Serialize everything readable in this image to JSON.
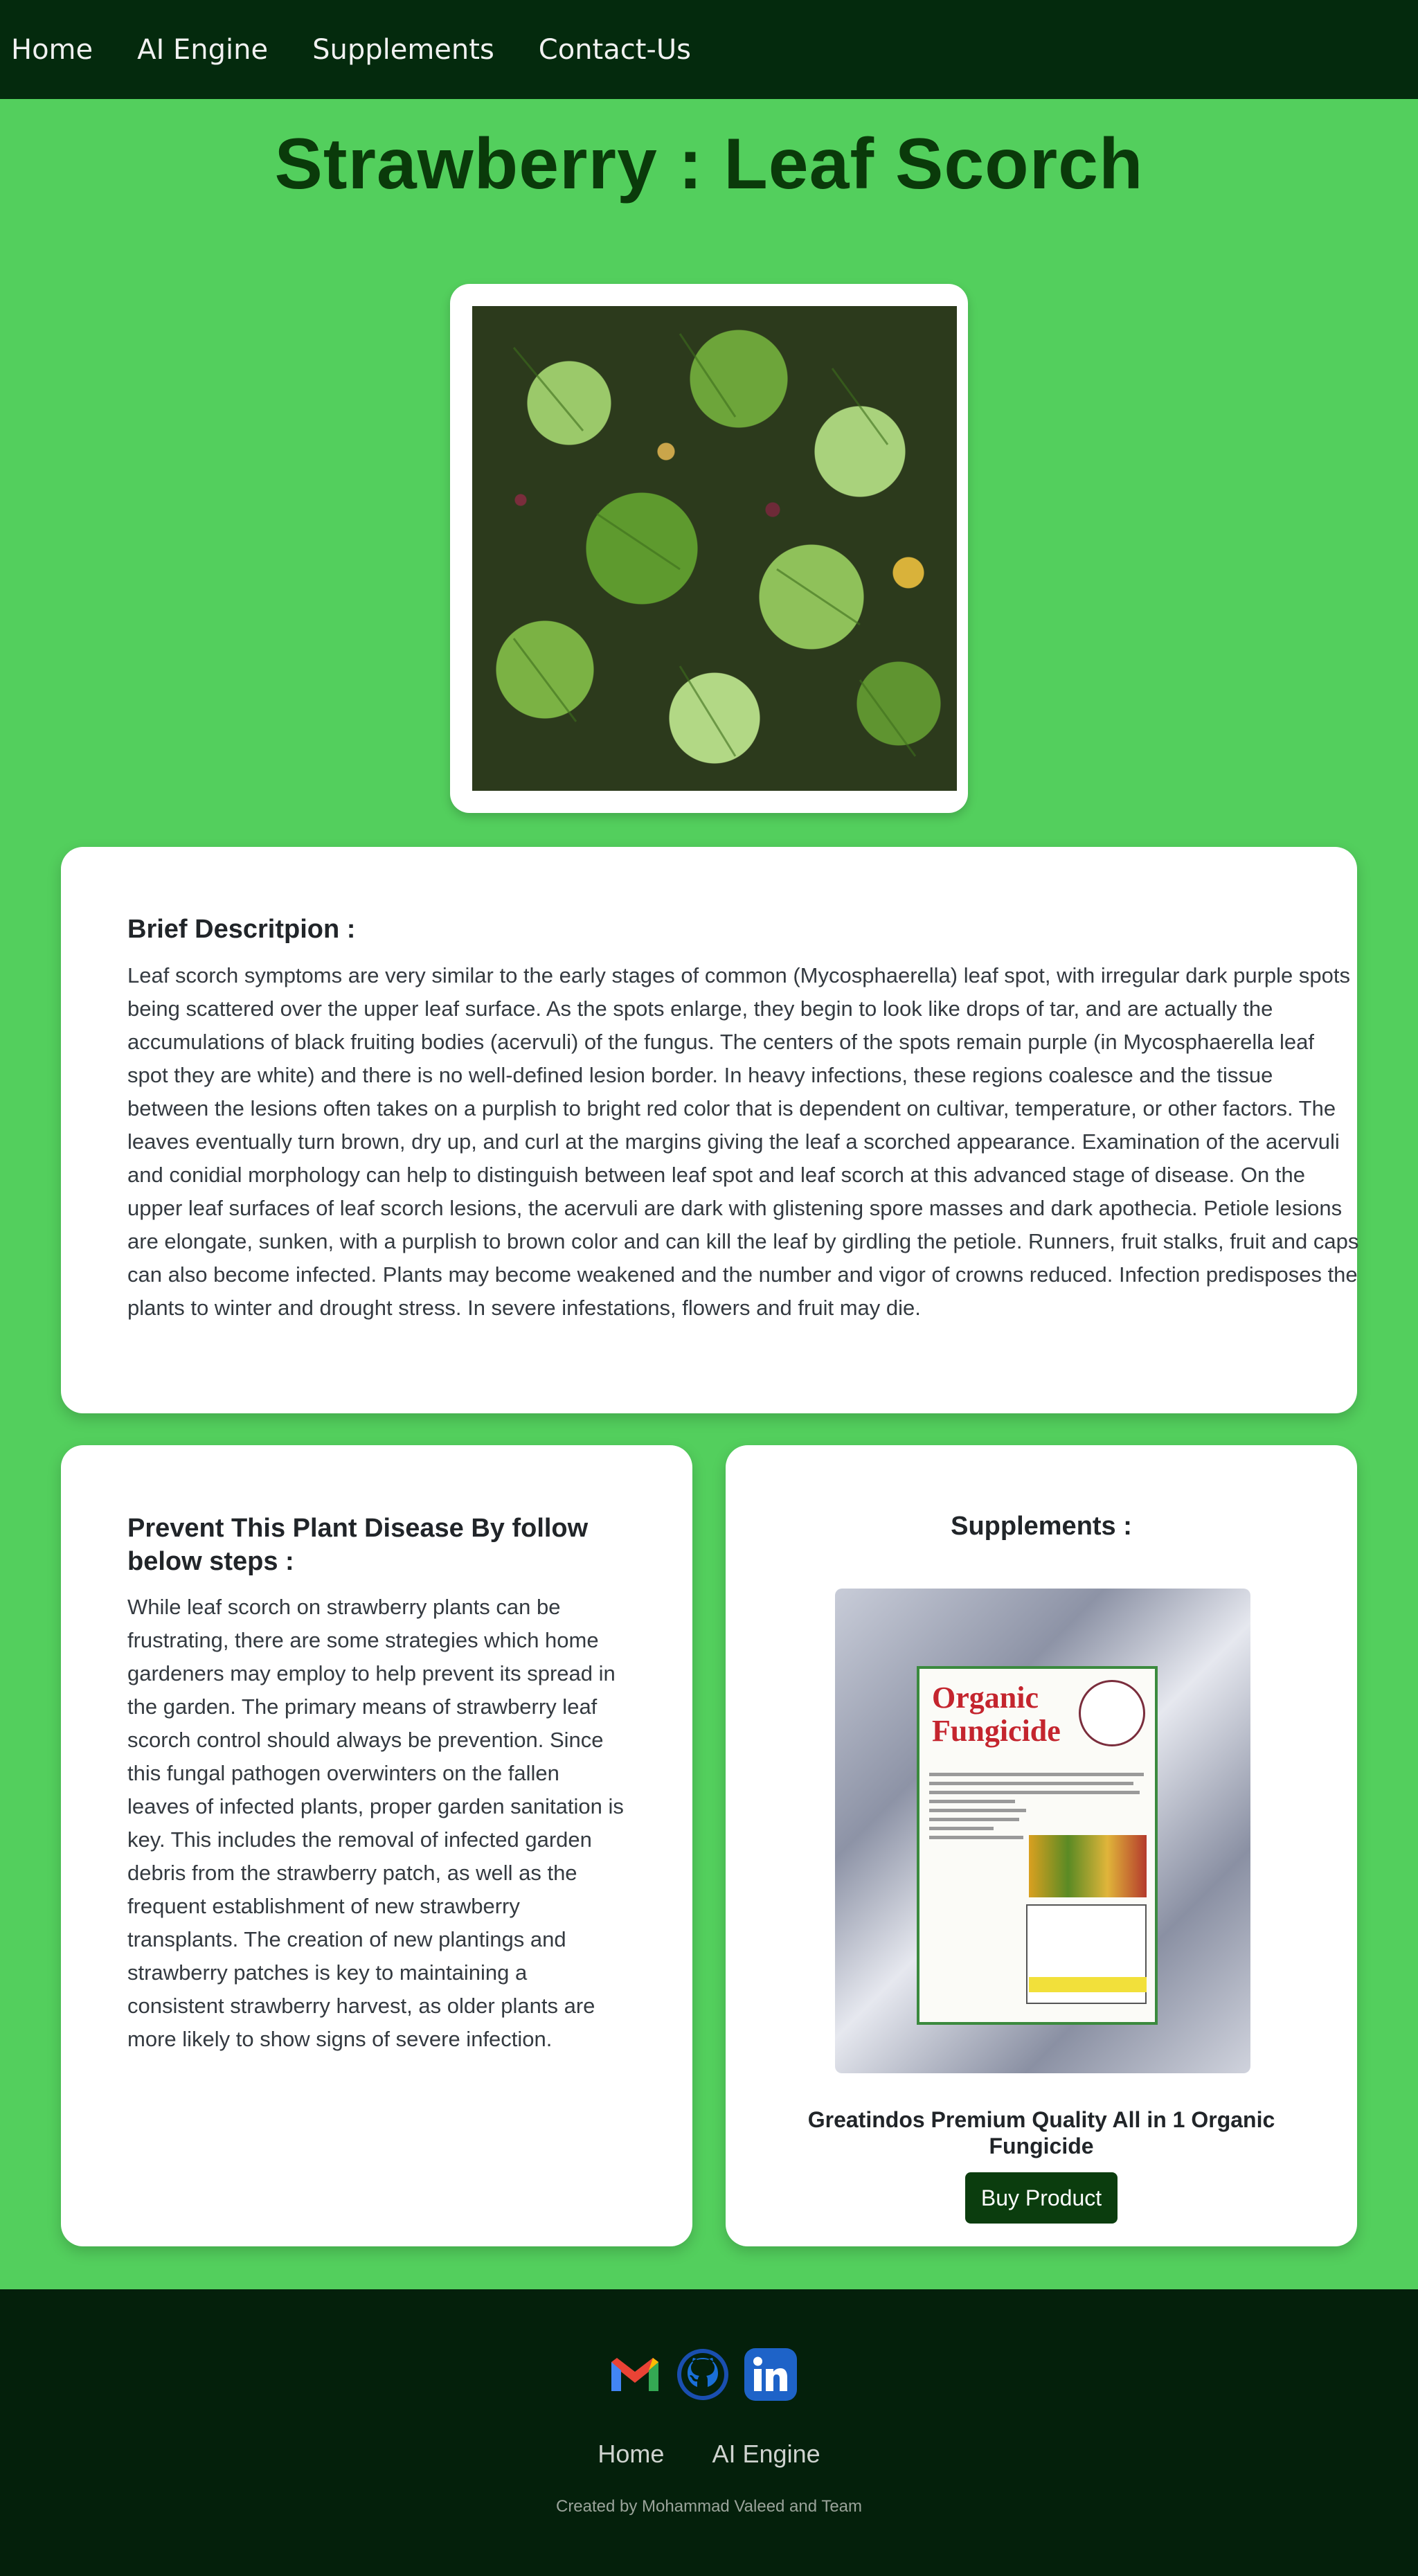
{
  "nav": {
    "items": [
      "Home",
      "AI Engine",
      "Supplements",
      "Contact-Us"
    ]
  },
  "page_title": "Strawberry : Leaf Scorch",
  "description": {
    "heading": "Brief Descritpion :",
    "text": "Leaf scorch symptoms are very similar to the early stages of common (Mycosphaerella) leaf spot, with irregular dark purple spots being scattered over the upper leaf surface. As the spots enlarge, they begin to look like drops of tar, and are actually the accumulations of black fruiting bodies (acervuli) of the fungus. The centers of the spots remain purple (in Mycosphaerella leaf spot they are white) and there is no well-defined lesion border. In heavy infections, these regions coalesce and the tissue between the lesions often takes on a purplish to bright red color that is dependent on cultivar, temperature, or other factors. The leaves eventually turn brown, dry up, and curl at the margins giving the leaf a scorched appearance. Examination of the acervuli and conidial morphology can help to distinguish between leaf spot and leaf scorch at this advanced stage of disease. On the upper leaf surfaces of leaf scorch lesions, the acervuli are dark with glistening spore masses and dark apothecia. Petiole lesions are elongate, sunken, with a purplish to brown color and can kill the leaf by girdling the petiole. Runners, fruit stalks, fruit and caps can also become infected. Plants may become weakened and the number and vigor of crowns reduced. Infection predisposes the plants to winter and drought stress. In severe infestations, flowers and fruit may die."
  },
  "prevent": {
    "heading": "Prevent This Plant Disease By follow below steps :",
    "text": "While leaf scorch on strawberry plants can be frustrating, there are some strategies which home gardeners may employ to help prevent its spread in the garden. The primary means of strawberry leaf scorch control should always be prevention. Since this fungal pathogen overwinters on the fallen leaves of infected plants, proper garden sanitation is key. This includes the removal of infected garden debris from the strawberry patch, as well as the frequent establishment of new strawberry transplants. The creation of new plantings and strawberry patches is key to maintaining a consistent strawberry harvest, as older plants are more likely to show signs of severe infection."
  },
  "supplements": {
    "heading": "Supplements :",
    "product_label_title": "Organic Fungicide",
    "product_name": "Greatindos Premium Quality All in 1 Organic Fungicide",
    "buy_label": "Buy Product"
  },
  "footer": {
    "social_icons": [
      "gmail-icon",
      "github-icon",
      "linkedin-icon"
    ],
    "links": [
      "Home",
      "AI Engine"
    ],
    "credit": "Created by Mohammad Valeed and Team"
  },
  "colors": {
    "page_bg": "#53cf5d",
    "nav_bg": "#042a0d",
    "footer_bg": "#04200b",
    "title": "#0a3a0a",
    "button_bg": "#0b3d0e"
  }
}
